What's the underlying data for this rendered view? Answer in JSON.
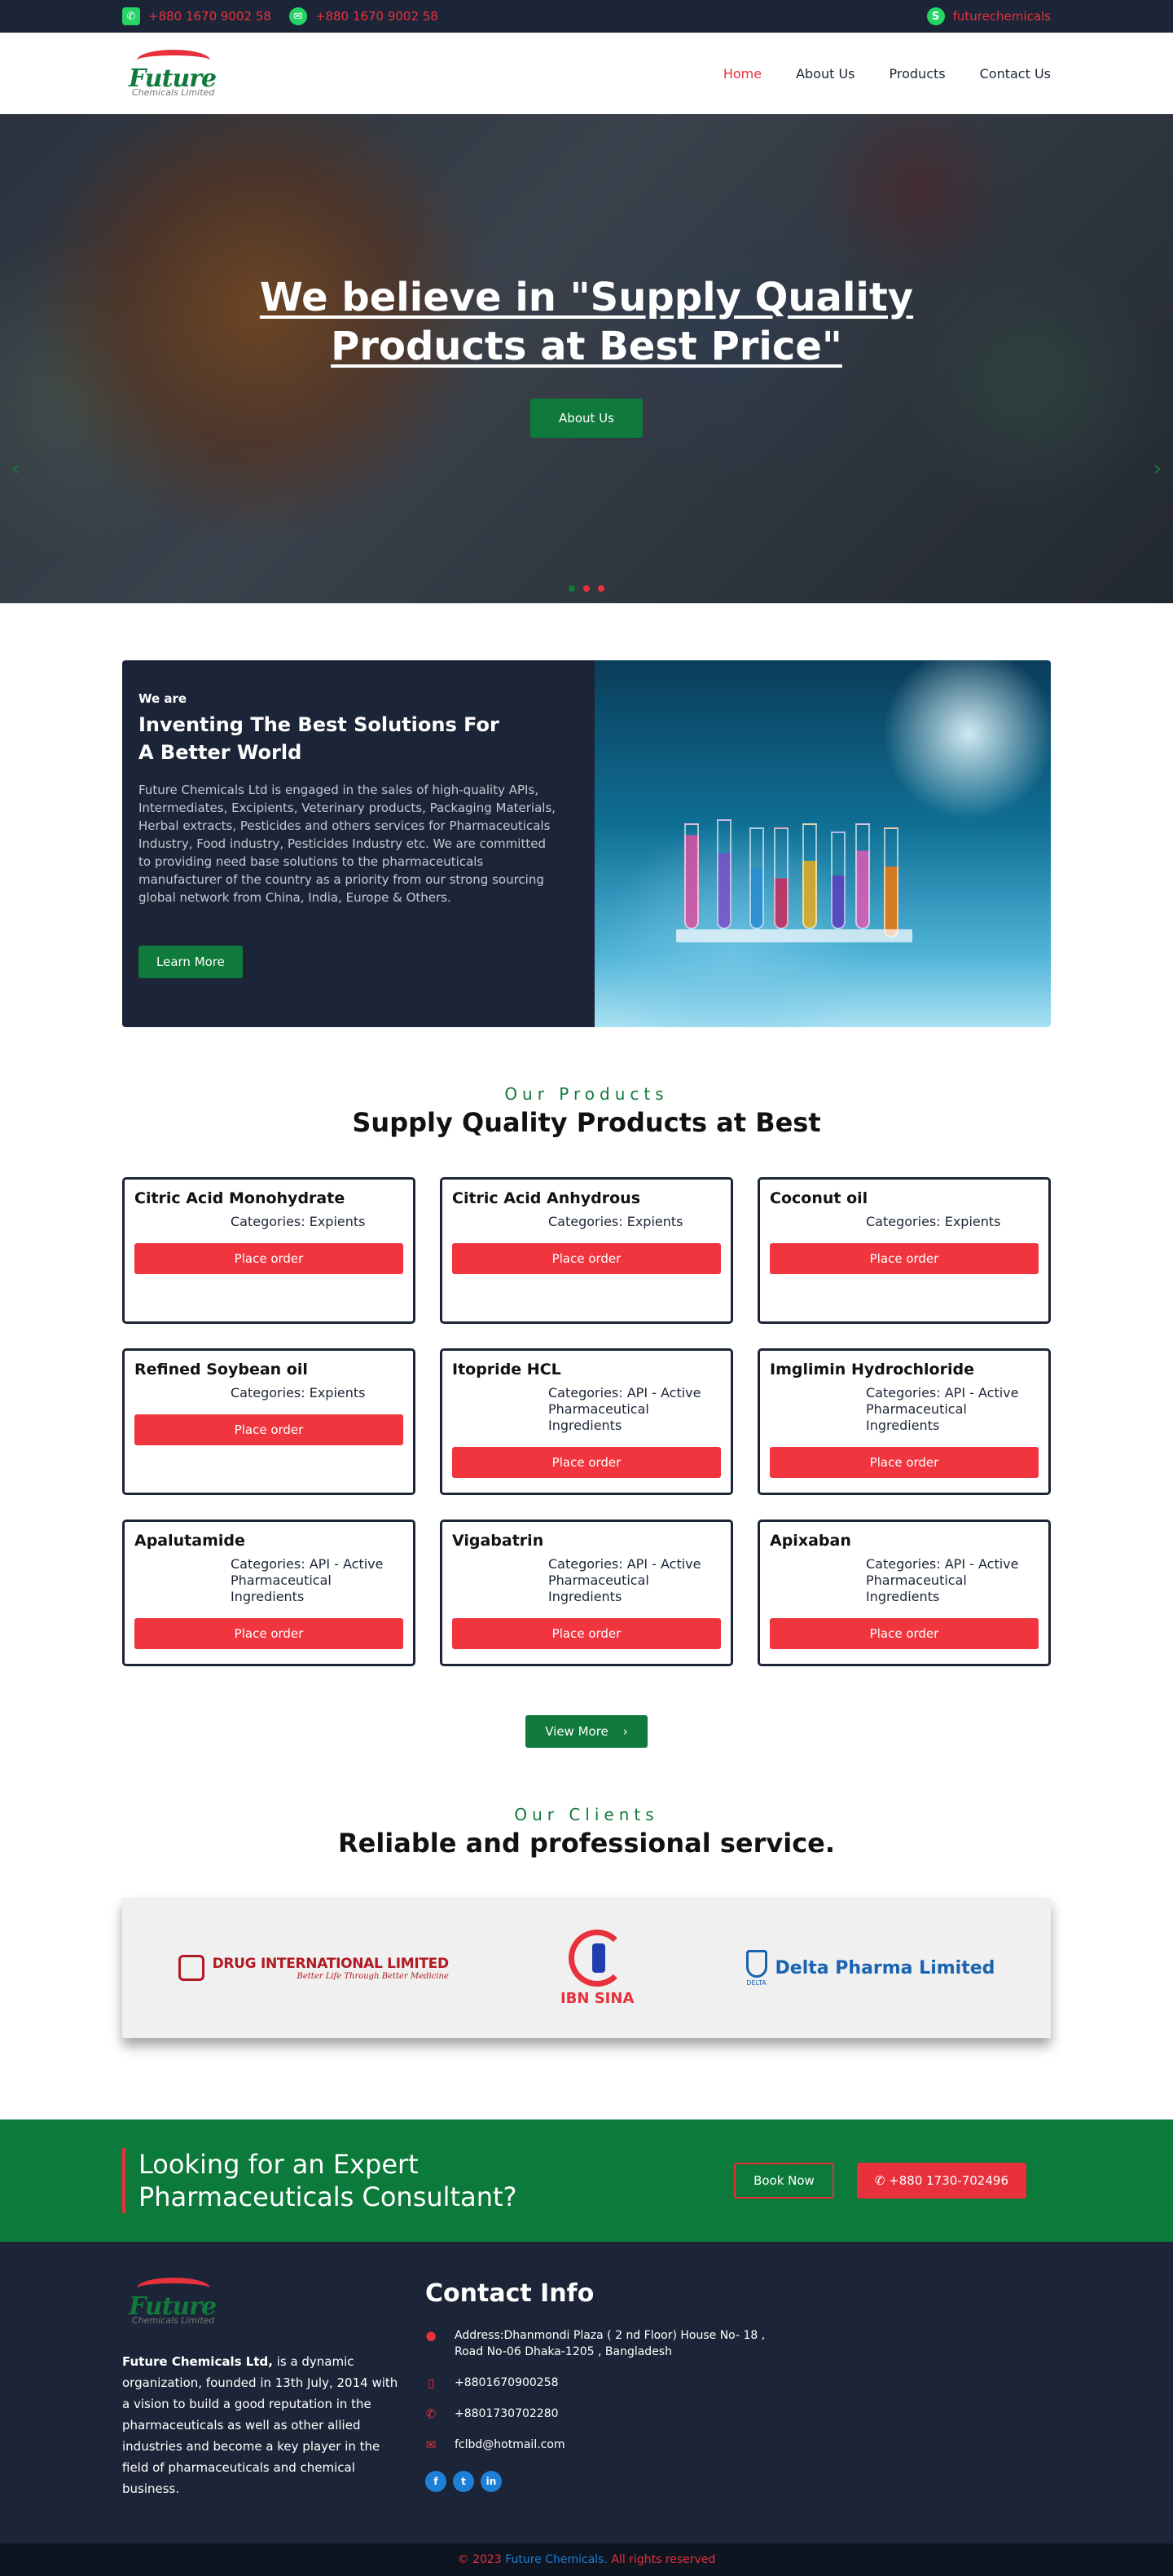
{
  "topbar": {
    "phone1": "+880 1670 9002 58",
    "phone2": "+880 1670 9002 58",
    "skype": "futurechemicals",
    "colors": {
      "bg": "#1c2537",
      "accent": "#e8313d",
      "icon": "#25d366"
    }
  },
  "logo": {
    "word": "Future",
    "sub": "Chemicals Limited"
  },
  "nav": {
    "home": "Home",
    "about": "About Us",
    "products": "Products",
    "contact": "Contact Us"
  },
  "hero": {
    "headline": "We believe in \"Supply Quality Products at Best Price\"",
    "button": "About Us",
    "prev_icon": "chevron-left-icon",
    "next_icon": "chevron-right-icon"
  },
  "about": {
    "eyebrow": "We are",
    "title_line1": "Inventing The Best Solutions For",
    "title_line2": "A Better World",
    "body": "Future Chemicals Ltd is engaged in the sales of high-quality APIs, Intermediates, Excipients, Veterinary products, Packaging Materials, Herbal extracts, Pesticides and others services for Pharmaceuticals Industry, Food industry, Pesticides Industry etc. We are committed to providing need base solutions to the pharmaceuticals manufacturer of the country as a priority from our strong sourcing global network from China, India, Europe & Others.",
    "button": "Learn More"
  },
  "products": {
    "eyebrow": "Our Products",
    "title": "Supply Quality Products at Best",
    "order_label": "Place order",
    "items": [
      {
        "name": "Citric Acid Monohydrate",
        "category": "Categories: Expients"
      },
      {
        "name": "Citric Acid Anhydrous",
        "category": "Categories: Expients"
      },
      {
        "name": "Coconut oil",
        "category": "Categories: Expients"
      },
      {
        "name": "Refined Soybean oil",
        "category": "Categories: Expients"
      },
      {
        "name": "Itopride HCL",
        "category": "Categories: API - Active Pharmaceutical Ingredients"
      },
      {
        "name": "Imglimin Hydrochloride",
        "category": "Categories: API - Active Pharmaceutical Ingredients"
      },
      {
        "name": "Apalutamide",
        "category": "Categories: API - Active Pharmaceutical Ingredients"
      },
      {
        "name": "Vigabatrin",
        "category": "Categories: API - Active Pharmaceutical Ingredients"
      },
      {
        "name": "Apixaban",
        "category": "Categories: API - Active Pharmaceutical Ingredients"
      }
    ],
    "view_more": "View More"
  },
  "clients": {
    "eyebrow": "Our Clients",
    "title": "Reliable and professional service.",
    "drug_name": "DRUG INTERNATIONAL LIMITED",
    "drug_tag": "Better Life Through Better Medicine",
    "ibn_name": "IBN SINA",
    "delta_name": "Delta Pharma Limited",
    "delta_mark": "DELTA"
  },
  "cta": {
    "title_line1": "Looking for an Expert",
    "title_line2": "Pharmaceuticals Consultant?",
    "book": "Book Now",
    "call": "+880 1730-702496"
  },
  "footer": {
    "company_bold": "Future Chemicals Ltd,",
    "company_text": " is a dynamic organization, founded in 13th July, 2014 with a vision to build a good reputation in the pharmaceuticals as well as other allied industries and become a key player in the field of pharmaceuticals and chemical business.",
    "contact_title": "Contact Info",
    "address": "Address:Dhanmondi Plaza ( 2 nd Floor) House No- 18 , Road No-06 Dhaka-1205 , Bangladesh",
    "phone1": "+8801670900258",
    "phone2": "+8801730702280",
    "email": "fclbd@hotmail.com",
    "copy_prefix": "© 2023",
    "copy_brand": "Future Chemicals.",
    "copy_suffix": "All rights reserved"
  }
}
